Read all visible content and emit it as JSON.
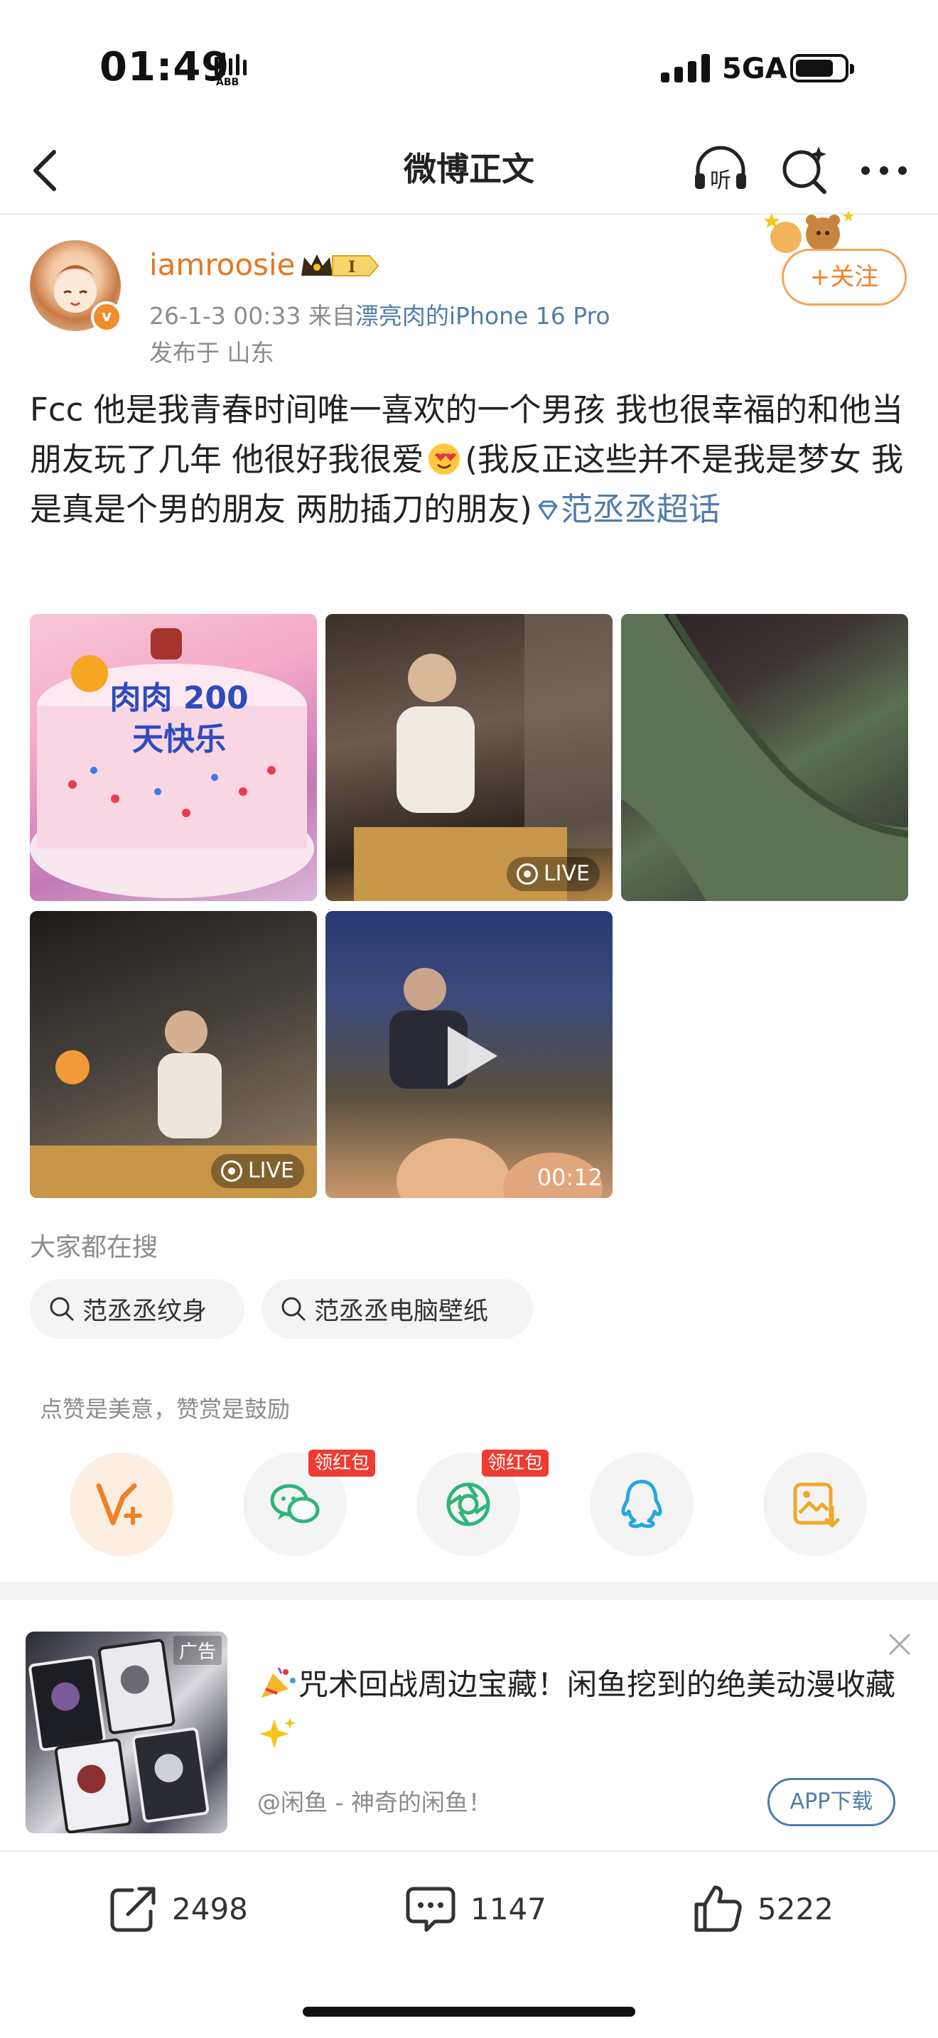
{
  "status_bar": {
    "time": "01:49",
    "network": "5GA",
    "icon": "activity-bars-icon"
  },
  "nav": {
    "title": "微博正文",
    "back_icon": "back-chevron-icon",
    "listen_icon": "listen-headphones-icon",
    "listen_label": "听",
    "search_icon": "search-sparkle-icon",
    "more_icon": "more-dots-icon"
  },
  "post": {
    "username": "iamroosie",
    "vip_level": "I",
    "date": "26-1-3 00:33",
    "source_prefix": "来自",
    "source": "漂亮肉的iPhone 16 Pro",
    "location": "发布于 山东",
    "follow_label": "+关注",
    "text_part1": "Fcc 他是我青春时间唯一喜欢的一个男孩 我也很幸福的和他当朋友玩了几年  他很好我很爱",
    "text_part2": "(我反正这些并不是我是梦女 我是真是个男的朋友 两肋插刀的朋友)",
    "topic": "范丞丞超话",
    "cake_text": "肉肉 200天快乐",
    "images": [
      {
        "kind": "photo",
        "label": ""
      },
      {
        "kind": "live",
        "label": "LIVE"
      },
      {
        "kind": "photo",
        "label": ""
      },
      {
        "kind": "live",
        "label": "LIVE"
      },
      {
        "kind": "video",
        "label": "00:12"
      }
    ]
  },
  "searches": {
    "heading": "大家都在搜",
    "items": [
      "范丞丞纹身",
      "范丞丞电脑壁纸"
    ]
  },
  "reward": {
    "note": "点赞是美意，赞赏是鼓励",
    "hongbao_label": "领红包",
    "buttons": [
      "vip-reward-icon",
      "wechat-icon",
      "moments-icon",
      "qq-icon",
      "save-image-icon"
    ]
  },
  "ad": {
    "label": "广告",
    "title": "咒术回战周边宝藏！闲鱼挖到的绝美动漫收藏",
    "source": "@闲鱼 - 神奇的闲鱼！",
    "button": "APP下载"
  },
  "toolbar": {
    "reposts": "2498",
    "comments": "1147",
    "likes": "5222"
  },
  "colors": {
    "accent_orange": "#f08127",
    "link_blue": "#4f7cad",
    "hongbao_red": "#ef3b30"
  }
}
